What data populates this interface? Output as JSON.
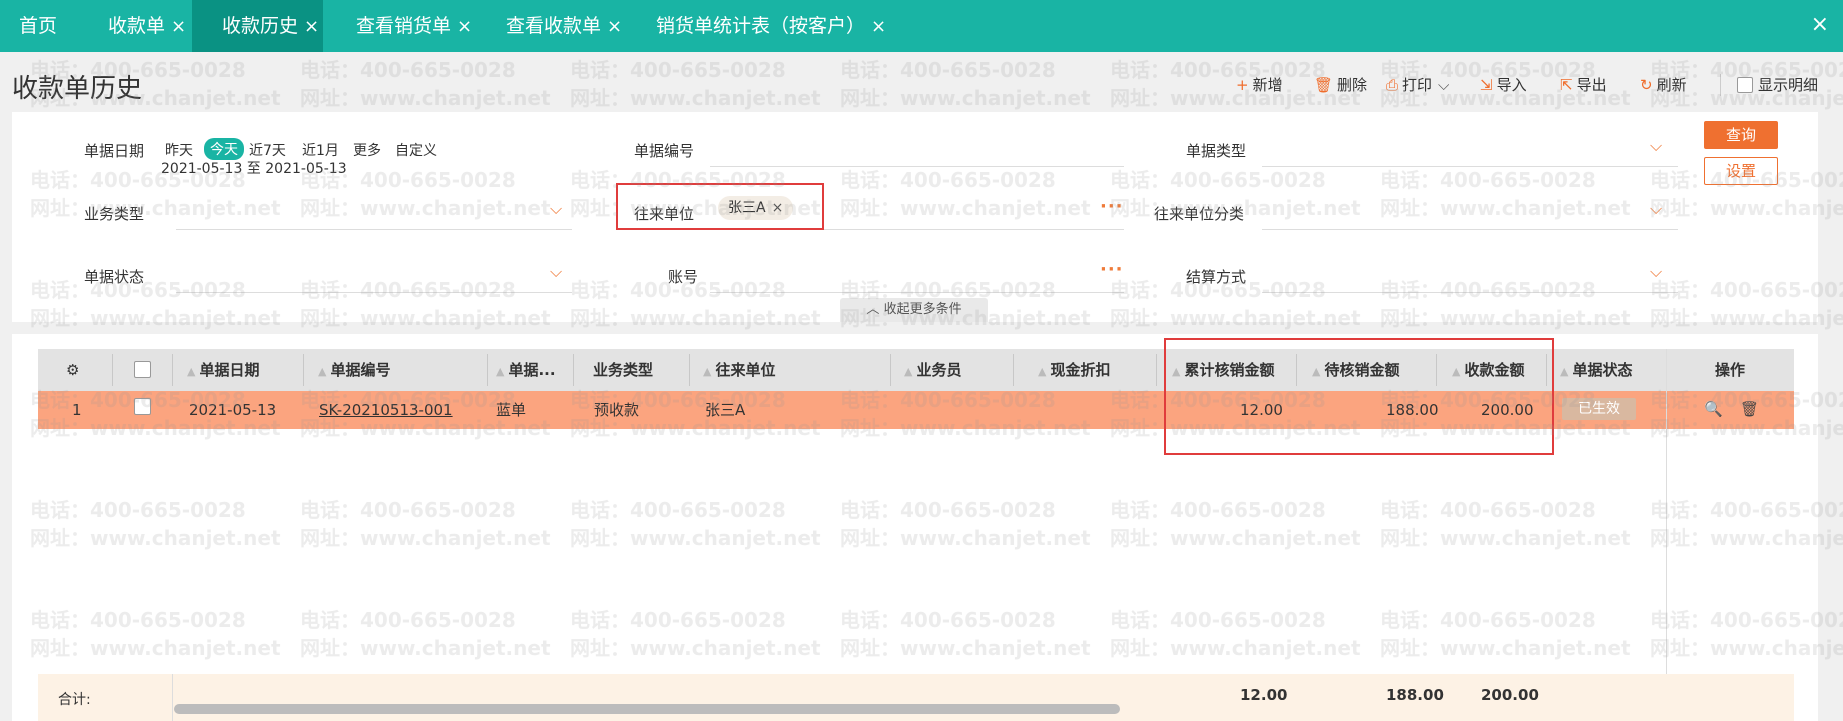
{
  "tabs": [
    {
      "label": "首页",
      "closable": false
    },
    {
      "label": "收款单",
      "closable": true
    },
    {
      "label": "收款历史",
      "closable": true,
      "active": true
    },
    {
      "label": "查看销货单",
      "closable": true
    },
    {
      "label": "查看收款单",
      "closable": true
    },
    {
      "label": "销货单统计表（按客户）",
      "closable": true
    }
  ],
  "close_glyph": "×",
  "page_title": "收款单历史",
  "toolbar": {
    "add": "新增",
    "delete": "删除",
    "print": "打印",
    "import": "导入",
    "export": "导出",
    "refresh": "刷新",
    "show_detail": "显示明细"
  },
  "filter": {
    "date_label": "单据日期",
    "date_options": [
      "昨天",
      "今天",
      "近7天",
      "近1月",
      "更多",
      "自定义"
    ],
    "date_selected": "今天",
    "date_range": "2021-05-13 至 2021-05-13",
    "doc_no_label": "单据编号",
    "doc_type_label": "单据类型",
    "biz_type_label": "业务类型",
    "partner_label": "往来单位",
    "partner_tag": "张三A",
    "partner_category_label": "往来单位分类",
    "status_label": "单据状态",
    "account_label": "账号",
    "settle_label": "结算方式",
    "query_btn": "查询",
    "setting_btn": "设置",
    "collapse": "收起更多条件"
  },
  "table": {
    "headers": {
      "date": "单据日期",
      "doc_no": "单据编号",
      "doc_kind": "单据...",
      "biz_type": "业务类型",
      "partner": "往来单位",
      "salesman": "业务员",
      "cash_discount": "现金折扣",
      "accum_written_off": "累计核销金额",
      "pending_write_off": "待核销金额",
      "amount": "收款金额",
      "status": "单据状态",
      "ops": "操作"
    },
    "rows": [
      {
        "index": "1",
        "date": "2021-05-13",
        "doc_no": "SK-20210513-001",
        "doc_kind": "蓝单",
        "biz_type": "预收款",
        "partner": "张三A",
        "accum_written_off": "12.00",
        "pending_write_off": "188.00",
        "amount": "200.00",
        "status": "已生效"
      }
    ],
    "summary": {
      "label": "合计:",
      "accum_written_off": "12.00",
      "pending_write_off": "188.00",
      "amount": "200.00"
    }
  },
  "watermark": {
    "phone": "电话：400-665-0028",
    "site": "网址：www.chanjet.net"
  },
  "colors": {
    "tab_bar": "#19b4a4",
    "tab_active": "#0a9283",
    "accent": "#ef7030",
    "row_highlight": "#fba47f",
    "highlight_box": "#e03c3c"
  }
}
